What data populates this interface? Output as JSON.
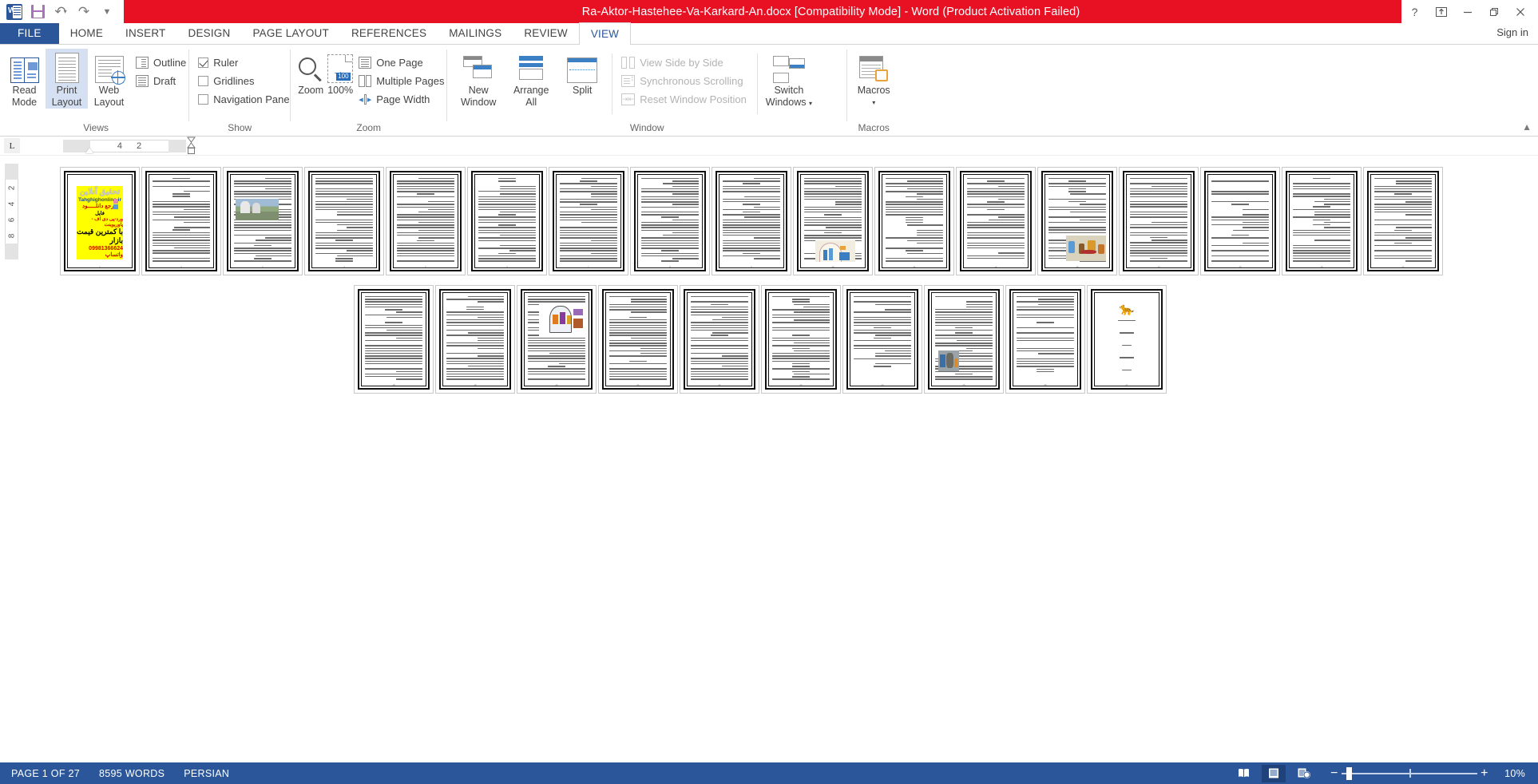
{
  "window": {
    "title": "Ra-Aktor-Hastehee-Va-Karkard-An.docx [Compatibility Mode] -  Word (Product Activation Failed)",
    "signin": "Sign in",
    "help_icon": "?",
    "ribbon_display_icon": "ribbon-display-options-icon",
    "minimize_icon": "minimize-icon",
    "restore_icon": "restore-icon",
    "close_icon": "close-icon"
  },
  "quick_access": {
    "app_icon": "word-app-icon",
    "save_icon": "save-icon",
    "undo_icon": "undo-icon",
    "redo_icon": "redo-icon",
    "customize_icon": "customize-quick-access-toolbar-icon"
  },
  "tabs": [
    {
      "label": "FILE",
      "active": false,
      "file": true
    },
    {
      "label": "HOME",
      "active": false
    },
    {
      "label": "INSERT",
      "active": false
    },
    {
      "label": "DESIGN",
      "active": false
    },
    {
      "label": "PAGE LAYOUT",
      "active": false
    },
    {
      "label": "REFERENCES",
      "active": false
    },
    {
      "label": "MAILINGS",
      "active": false
    },
    {
      "label": "REVIEW",
      "active": false
    },
    {
      "label": "VIEW",
      "active": true
    }
  ],
  "ribbon": {
    "collapse_icon": "collapse-ribbon-icon",
    "groups": [
      {
        "name": "Views",
        "label": "Views",
        "buttons": [
          {
            "label_top": "Read",
            "label_bottom": "Mode",
            "selected": false,
            "icon": "read-mode-icon"
          },
          {
            "label_top": "Print",
            "label_bottom": "Layout",
            "selected": true,
            "icon": "print-layout-icon"
          },
          {
            "label_top": "Web",
            "label_bottom": "Layout",
            "selected": false,
            "icon": "web-layout-icon"
          }
        ],
        "small_items": [
          {
            "label": "Outline",
            "icon": "outline-view-icon"
          },
          {
            "label": "Draft",
            "icon": "draft-view-icon"
          }
        ]
      },
      {
        "name": "Show",
        "label": "Show",
        "checkboxes": [
          {
            "label": "Ruler",
            "checked": true
          },
          {
            "label": "Gridlines",
            "checked": false
          },
          {
            "label": "Navigation Pane",
            "checked": false
          }
        ]
      },
      {
        "name": "Zoom",
        "label": "Zoom",
        "buttons": [
          {
            "label_top": "Zoom",
            "label_bottom": "",
            "icon": "zoom-magnifier-icon"
          },
          {
            "label_top": "100%",
            "label_bottom": "",
            "icon": "zoom-100-icon"
          }
        ],
        "small_items": [
          {
            "label": "One Page",
            "icon": "one-page-icon"
          },
          {
            "label": "Multiple Pages",
            "icon": "multiple-pages-icon"
          },
          {
            "label": "Page Width",
            "icon": "page-width-icon"
          }
        ]
      },
      {
        "name": "Window",
        "label": "Window",
        "buttons": [
          {
            "label_top": "New",
            "label_bottom": "Window",
            "icon": "new-window-icon"
          },
          {
            "label_top": "Arrange",
            "label_bottom": "All",
            "icon": "arrange-all-icon"
          },
          {
            "label_top": "Split",
            "label_bottom": "",
            "icon": "split-icon"
          }
        ],
        "small_items": [
          {
            "label": "View Side by Side",
            "icon": "view-side-by-side-icon",
            "disabled": true
          },
          {
            "label": "Synchronous Scrolling",
            "icon": "synchronous-scrolling-icon",
            "disabled": true
          },
          {
            "label": "Reset Window Position",
            "icon": "reset-window-position-icon",
            "disabled": true
          }
        ],
        "buttons2": [
          {
            "label_top": "Switch",
            "label_bottom": "Windows",
            "icon": "switch-windows-icon",
            "dropdown": true
          }
        ]
      },
      {
        "name": "Macros",
        "label": "Macros",
        "buttons": [
          {
            "label_top": "Macros",
            "label_bottom": "",
            "icon": "macros-icon",
            "dropdown": true
          }
        ]
      }
    ]
  },
  "ruler": {
    "tab_stop_marker": "L",
    "horizontal_marks": [
      "4",
      "2"
    ],
    "vertical_marks": [
      "2",
      "4",
      "6",
      "8"
    ],
    "left_indent_icon": "left-indent-marker-icon",
    "right_indent_icon": "right-indent-marker-icon"
  },
  "document": {
    "ad_page": {
      "line1": "تحقیق آنلاین",
      "line2": "Tahghighonline.ir",
      "line3": "مرجع دانلـــــود",
      "line4": "فایل",
      "line5": "ورد-پی دی اف - پاوریوینت",
      "line6": "با کمترین قیمت بازار",
      "line7": "09981366624 واتساپ"
    },
    "row1_pages": [
      {
        "n": 1,
        "type": "ad"
      },
      {
        "n": 2,
        "type": "text"
      },
      {
        "n": 3,
        "type": "text-image",
        "image": "pic-towers"
      },
      {
        "n": 4,
        "type": "text"
      },
      {
        "n": 5,
        "type": "text"
      },
      {
        "n": 6,
        "type": "text"
      },
      {
        "n": 7,
        "type": "text"
      },
      {
        "n": 8,
        "type": "text"
      },
      {
        "n": 9,
        "type": "text"
      },
      {
        "n": 10,
        "type": "text-image",
        "image": "pic-reactor"
      },
      {
        "n": 11,
        "type": "text"
      },
      {
        "n": 12,
        "type": "text"
      },
      {
        "n": 13,
        "type": "text-image",
        "image": "pic-lab"
      },
      {
        "n": 14,
        "type": "text"
      },
      {
        "n": 15,
        "type": "text-sparse"
      },
      {
        "n": 16,
        "type": "text"
      },
      {
        "n": 17,
        "type": "text"
      }
    ],
    "row2_pages": [
      {
        "n": 18,
        "type": "text"
      },
      {
        "n": 19,
        "type": "text"
      },
      {
        "n": 20,
        "type": "text-image",
        "image": "pic-react2"
      },
      {
        "n": 21,
        "type": "text"
      },
      {
        "n": 22,
        "type": "text"
      },
      {
        "n": 23,
        "type": "text"
      },
      {
        "n": 24,
        "type": "text-sparse"
      },
      {
        "n": 25,
        "type": "text-image",
        "image": "pic-plant"
      },
      {
        "n": 26,
        "type": "text-sparse"
      },
      {
        "n": 27,
        "type": "cover"
      }
    ],
    "cover_page": {
      "icon": "butterfly-icon",
      "lines": [
        "منابع و ماخذ",
        "مقدمه",
        "بررسی اسناد",
        "نتیجه",
        "راکتور هسته ای",
        "منابع"
      ]
    }
  },
  "statusbar": {
    "page": "PAGE 1 OF 27",
    "words": "8595 WORDS",
    "language": "PERSIAN",
    "view_read_icon": "read-mode-view-icon",
    "view_print_icon": "print-layout-view-icon",
    "view_web_icon": "web-layout-view-icon",
    "zoom_out": "−",
    "zoom_in": "+",
    "zoom_level": "10%"
  },
  "colors": {
    "title_red": "#e81123",
    "accent_blue": "#2b579a",
    "tab_active": "#2b579a",
    "selection": "#d5e1f2"
  }
}
